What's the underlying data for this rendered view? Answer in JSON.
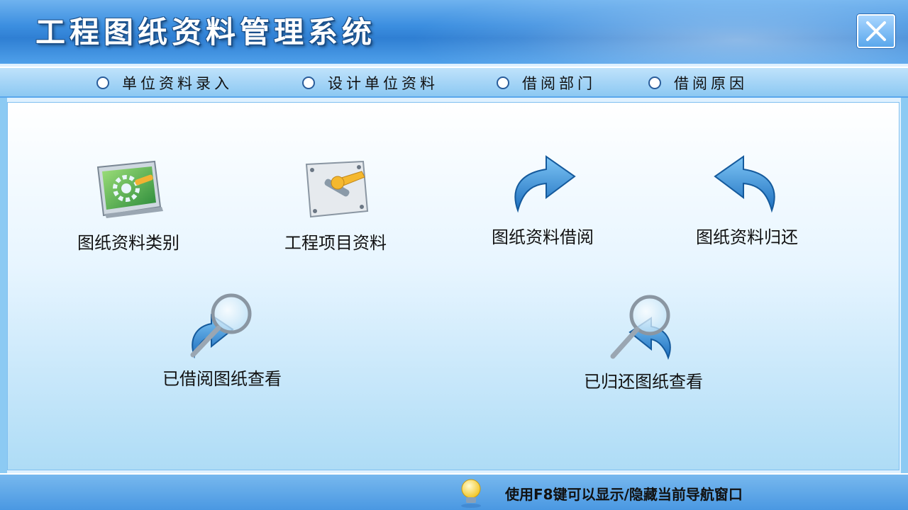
{
  "window": {
    "title": "工程图纸资料管理系统"
  },
  "tabs": [
    {
      "label": "单位资料录入"
    },
    {
      "label": "设计单位资料"
    },
    {
      "label": "借阅部门"
    },
    {
      "label": "借阅原因"
    }
  ],
  "launchers": [
    {
      "label": "图纸资料类别",
      "icon": "monitor-gear-icon"
    },
    {
      "label": "工程项目资料",
      "icon": "wrench-panel-icon"
    },
    {
      "label": "图纸资料借阅",
      "icon": "arrow-right-curved-icon"
    },
    {
      "label": "图纸资料归还",
      "icon": "arrow-left-curved-icon"
    },
    {
      "label": "已借阅图纸查看",
      "icon": "magnifier-arrow-icon"
    },
    {
      "label": "已归还图纸查看",
      "icon": "magnifier-arrow-back-icon"
    }
  ],
  "status": {
    "hint": "使用F8键可以显示/隐藏当前导航窗口",
    "icon": "lightbulb-icon"
  },
  "colors": {
    "titlebar": "#3c8fe0",
    "panel": "#e7f5ff",
    "accent": "#2f7fd3"
  }
}
